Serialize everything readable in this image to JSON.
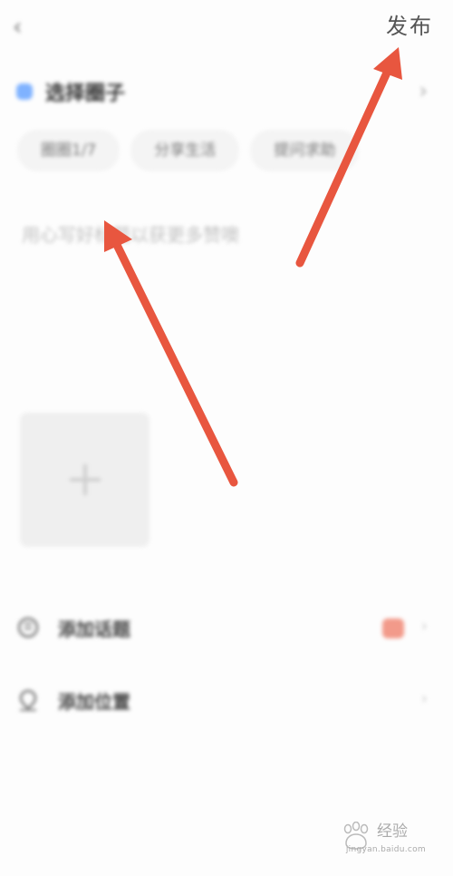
{
  "header": {
    "back_icon": "chevron-left-icon",
    "back_glyph": "‹",
    "publish_label": "发布"
  },
  "circle": {
    "label": "选择圈子",
    "dot_color": "#7fb2ff",
    "chevron_glyph": "›"
  },
  "chips": [
    {
      "label": "圈圈1/7"
    },
    {
      "label": "分享生活"
    },
    {
      "label": "提问求助"
    }
  ],
  "content": {
    "placeholder": "用心写好标题以获更多赞噢"
  },
  "add_image": {
    "icon": "plus-icon"
  },
  "options": {
    "topic": {
      "label": "添加话题",
      "icon": "topic-icon",
      "badge_color": "#f29a8a"
    },
    "location": {
      "label": "添加位置",
      "icon": "location-icon"
    }
  },
  "annotations": {
    "arrow_color": "#e8563f"
  },
  "watermark": {
    "text": "经验",
    "url": "jingyan.baidu.com"
  }
}
